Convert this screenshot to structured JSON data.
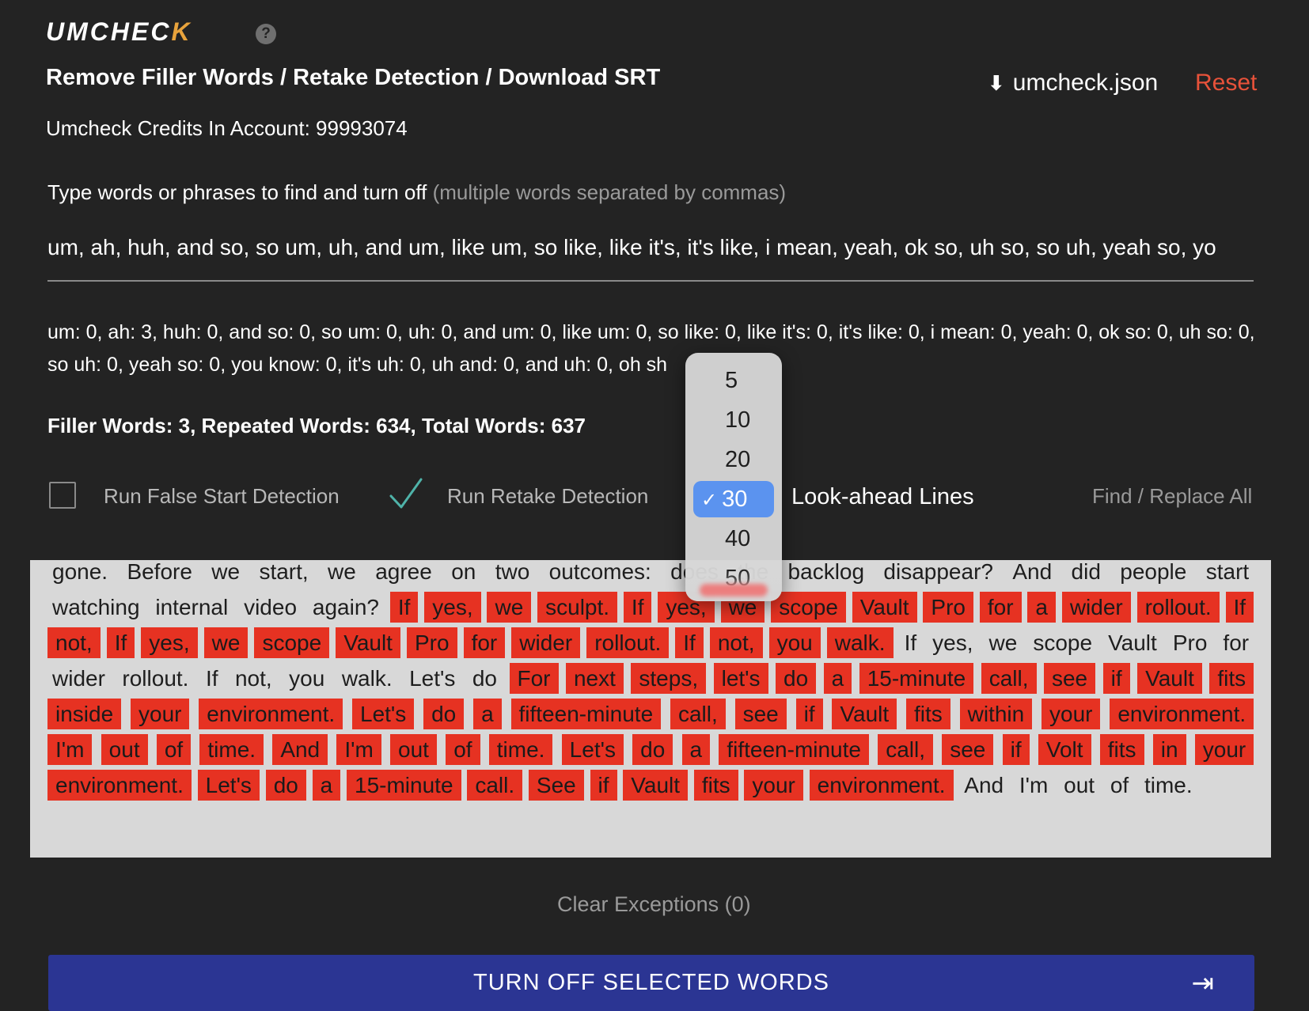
{
  "header": {
    "logo_main": "UMCHEC",
    "logo_mark": "K",
    "title": "Remove Filler Words / Retake Detection / Download SRT",
    "download_label": "umcheck.json",
    "reset_label": "Reset",
    "credits": "Umcheck Credits In Account: 99993074"
  },
  "filler_field": {
    "label": "Type words or phrases to find and turn off",
    "hint": "(multiple words separated by commas)",
    "value": "um, ah, huh, and so, so um, uh, and um, like um, so like, like it's, it's like, i mean, yeah, ok so, uh so, so uh, yeah so, yo"
  },
  "counts_text": "um: 0, ah: 3, huh: 0, and so: 0, so um: 0, uh: 0, and um: 0, like um: 0, so like: 0, like it's: 0, it's like: 0, i mean: 0, yeah: 0, ok so: 0, uh so: 0, so uh: 0, yeah so: 0, you know: 0, it's uh: 0, uh and: 0, and uh: 0, oh sh",
  "stats_summary": "Filler Words: 3, Repeated Words: 634, Total Words: 637",
  "options": {
    "false_start_label": "Run False Start Detection",
    "false_start_checked": false,
    "retake_label": "Run Retake Detection",
    "retake_checked": true,
    "lookahead_label": "Look-ahead Lines",
    "find_replace_label": "Find / Replace All"
  },
  "lookahead_dropdown": {
    "options": [
      "5",
      "10",
      "20",
      "30",
      "40",
      "50"
    ],
    "selected": "30",
    "check_mark": "✓"
  },
  "transcript": {
    "words": [
      [
        "gone.",
        0
      ],
      [
        "Before",
        0
      ],
      [
        "we",
        0
      ],
      [
        "start,",
        0
      ],
      [
        "we",
        0
      ],
      [
        "agree",
        0
      ],
      [
        "on",
        0
      ],
      [
        "two",
        0
      ],
      [
        "outcomes:",
        0
      ],
      [
        "does",
        0
      ],
      [
        "the",
        0
      ],
      [
        "backlog",
        0
      ],
      [
        "disappear?",
        0
      ],
      [
        "And",
        0
      ],
      [
        "did",
        0
      ],
      [
        "people",
        0
      ],
      [
        "start",
        0
      ],
      [
        "watching",
        0
      ],
      [
        "internal",
        0
      ],
      [
        "video",
        0
      ],
      [
        "again?",
        0
      ],
      [
        "If",
        1
      ],
      [
        "yes,",
        1
      ],
      [
        "we",
        1
      ],
      [
        "sculpt.",
        1
      ],
      [
        "If",
        1
      ],
      [
        "yes,",
        1
      ],
      [
        "we",
        1
      ],
      [
        "scope",
        1
      ],
      [
        "Vault",
        1
      ],
      [
        "Pro",
        1
      ],
      [
        "for",
        1
      ],
      [
        "a",
        1
      ],
      [
        "wider",
        1
      ],
      [
        "rollout.",
        1
      ],
      [
        "If",
        1
      ],
      [
        "not,",
        1
      ],
      [
        "If",
        1
      ],
      [
        "yes,",
        1
      ],
      [
        "we",
        1
      ],
      [
        "scope",
        1
      ],
      [
        "Vault",
        1
      ],
      [
        "Pro",
        1
      ],
      [
        "for",
        1
      ],
      [
        "wider",
        1
      ],
      [
        "rollout.",
        1
      ],
      [
        "If",
        1
      ],
      [
        "not,",
        1
      ],
      [
        "you",
        1
      ],
      [
        "walk.",
        1
      ],
      [
        "If",
        0
      ],
      [
        "yes,",
        0
      ],
      [
        "we",
        0
      ],
      [
        "scope",
        0
      ],
      [
        "Vault",
        0
      ],
      [
        "Pro",
        0
      ],
      [
        "for",
        0
      ],
      [
        "wider",
        0
      ],
      [
        "rollout.",
        0
      ],
      [
        "If",
        0
      ],
      [
        "not,",
        0
      ],
      [
        "you",
        0
      ],
      [
        "walk.",
        0
      ],
      [
        "Let's",
        0
      ],
      [
        "do",
        0
      ],
      [
        "For",
        1
      ],
      [
        "next",
        1
      ],
      [
        "steps,",
        1
      ],
      [
        "let's",
        1
      ],
      [
        "do",
        1
      ],
      [
        "a",
        1
      ],
      [
        "15-minute",
        1
      ],
      [
        "call,",
        1
      ],
      [
        "see",
        1
      ],
      [
        "if",
        1
      ],
      [
        "Vault",
        1
      ],
      [
        "fits",
        1
      ],
      [
        "inside",
        1
      ],
      [
        "your",
        1
      ],
      [
        "environment.",
        1
      ],
      [
        "Let's",
        1
      ],
      [
        "do",
        1
      ],
      [
        "a",
        1
      ],
      [
        "fifteen-minute",
        1
      ],
      [
        "call,",
        1
      ],
      [
        "see",
        1
      ],
      [
        "if",
        1
      ],
      [
        "Vault",
        1
      ],
      [
        "fits",
        1
      ],
      [
        "within",
        1
      ],
      [
        "your",
        1
      ],
      [
        "environment.",
        1
      ],
      [
        "I'm",
        1
      ],
      [
        "out",
        1
      ],
      [
        "of",
        1
      ],
      [
        "time.",
        1
      ],
      [
        "And",
        1
      ],
      [
        "I'm",
        1
      ],
      [
        "out",
        1
      ],
      [
        "of",
        1
      ],
      [
        "time.",
        1
      ],
      [
        "Let's",
        1
      ],
      [
        "do",
        1
      ],
      [
        "a",
        1
      ],
      [
        "fifteen-minute",
        1
      ],
      [
        "call,",
        1
      ],
      [
        "see",
        1
      ],
      [
        "if",
        1
      ],
      [
        "Volt",
        1
      ],
      [
        "fits",
        1
      ],
      [
        "in",
        1
      ],
      [
        "your",
        1
      ],
      [
        "environment.",
        1
      ],
      [
        "Let's",
        1
      ],
      [
        "do",
        1
      ],
      [
        "a",
        1
      ],
      [
        "15-minute",
        1
      ],
      [
        "call.",
        1
      ],
      [
        "See",
        1
      ],
      [
        "if",
        1
      ],
      [
        "Vault",
        1
      ],
      [
        "fits",
        1
      ],
      [
        "your",
        1
      ],
      [
        "environment.",
        1
      ],
      [
        "And",
        0
      ],
      [
        "I'm",
        0
      ],
      [
        "out",
        0
      ],
      [
        "of",
        0
      ],
      [
        "time.",
        0
      ]
    ]
  },
  "clear_exceptions_label": "Clear Exceptions (0)",
  "turn_off_button": {
    "label": "TURN OFF SELECTED WORDS",
    "icon": "⇥"
  },
  "colors": {
    "background": "#232323",
    "highlight": "#e63222",
    "accent_reset": "#e8523a",
    "button": "#2b3593",
    "dropdown_selected": "#5b93ef",
    "check": "#4fb3a9"
  },
  "icons": {
    "help": "?",
    "download": "⬇"
  }
}
